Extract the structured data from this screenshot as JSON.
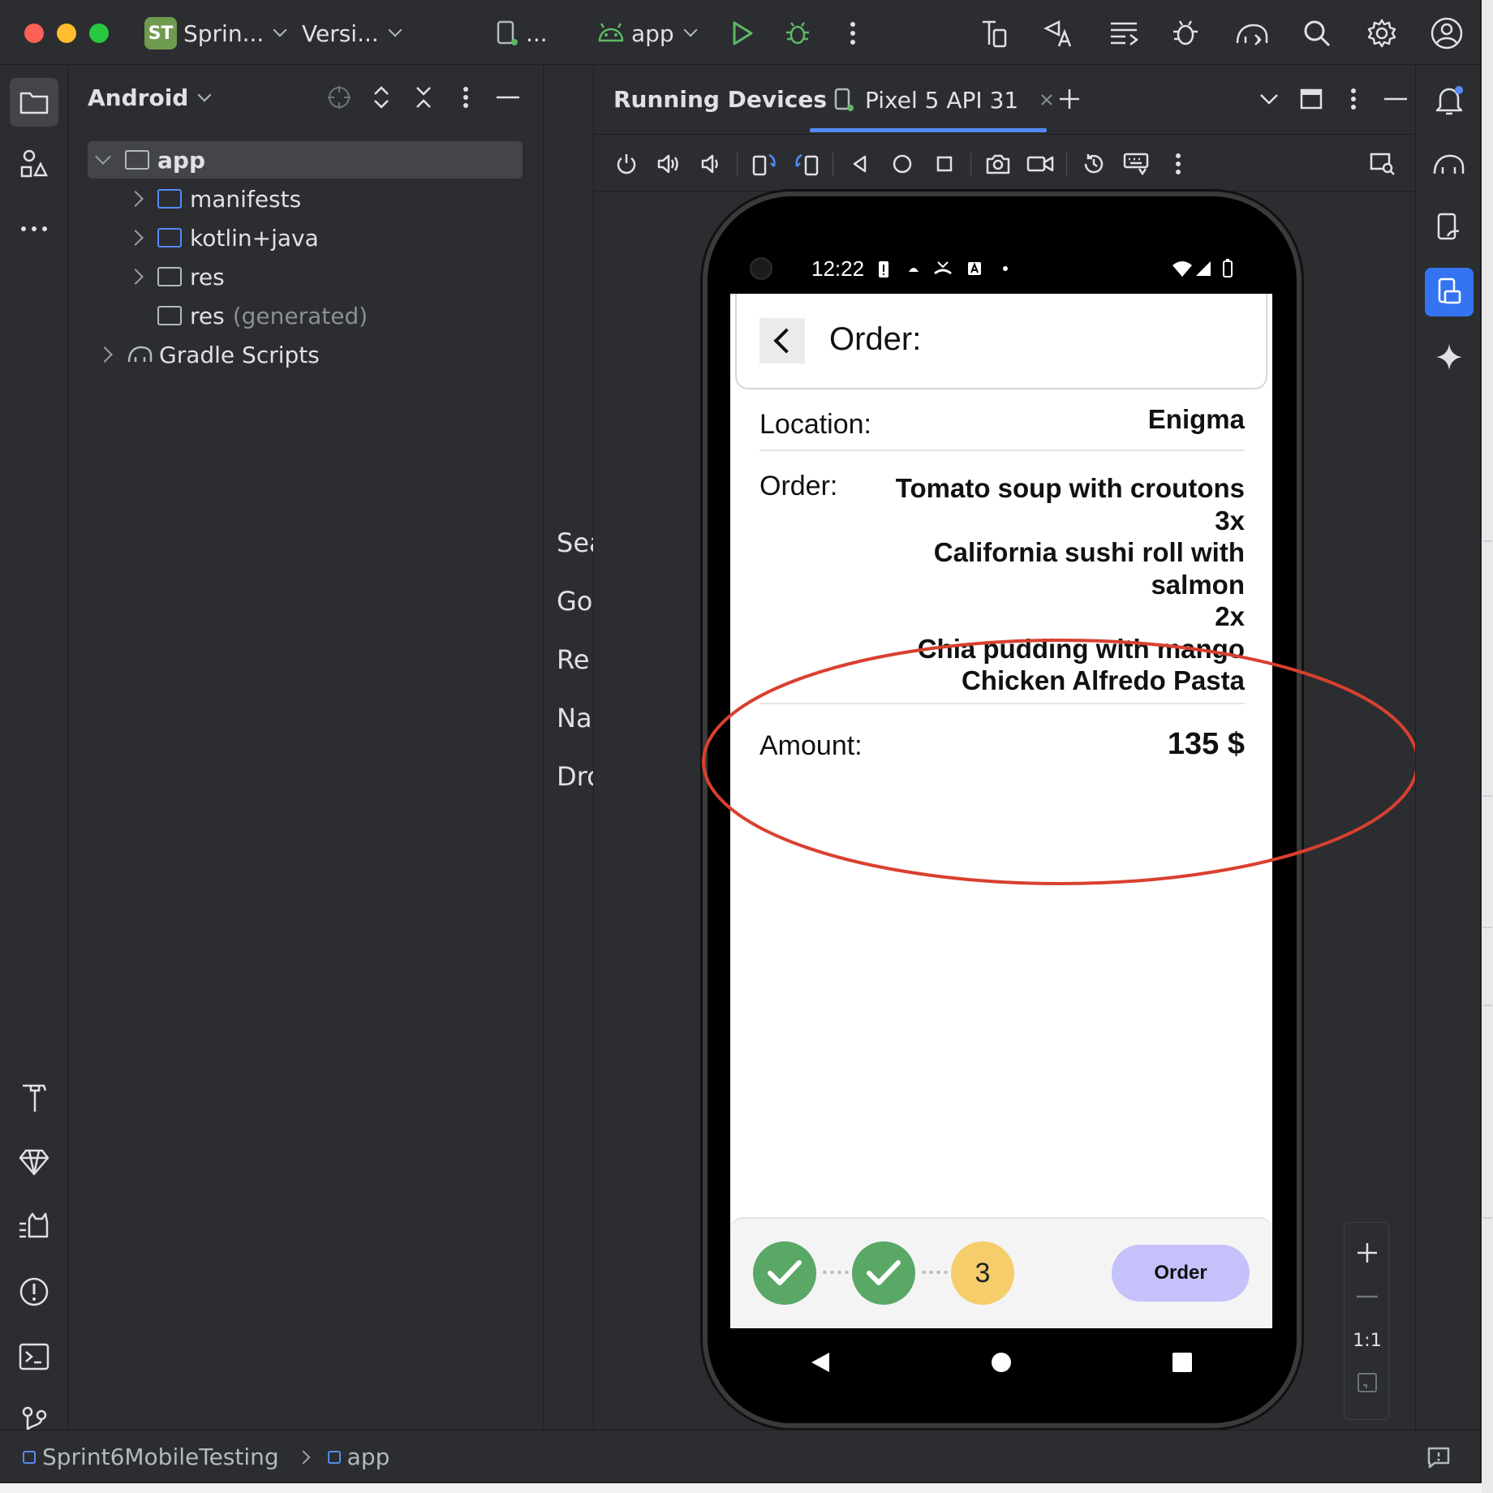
{
  "titlebar": {
    "project_badge": "ST",
    "project_name": "Sprin...",
    "vcs": "Versi...",
    "device_short": "...",
    "run_config": "app"
  },
  "project_panel": {
    "view": "Android",
    "tree": [
      {
        "label": "app"
      },
      {
        "label": "manifests"
      },
      {
        "label": "kotlin+java"
      },
      {
        "label": "res"
      },
      {
        "label": "res",
        "suffix": "(generated)"
      },
      {
        "label": "Gradle Scripts"
      }
    ]
  },
  "mid_panel": {
    "lines": [
      "Sea",
      "Go",
      "Re",
      "Na",
      "Dro"
    ]
  },
  "running_devices": {
    "title": "Running Devices",
    "tab": "Pixel 5 API 31"
  },
  "phone": {
    "time": "12:22",
    "header_title": "Order:",
    "location_label": "Location:",
    "location_value": "Enigma",
    "order_label": "Order:",
    "order_lines": [
      "Tomato soup with croutons",
      "3x",
      "California sushi roll with",
      "salmon",
      "2x",
      "Chia pudding with mango",
      "Chicken Alfredo Pasta"
    ],
    "amount_label": "Amount:",
    "amount_value": "135 $",
    "current_step": "3",
    "order_button": "Order"
  },
  "zoom": {
    "ratio": "1:1"
  },
  "breadcrumb": {
    "project": "Sprint6MobileTesting",
    "module": "app"
  },
  "colors": {
    "ide_bg": "#2b2d30",
    "accent": "#548af7",
    "annotation": "#d9402f",
    "step_done": "#5aa865",
    "step_current": "#f5cd6a",
    "order_button": "#c5c1fb"
  }
}
